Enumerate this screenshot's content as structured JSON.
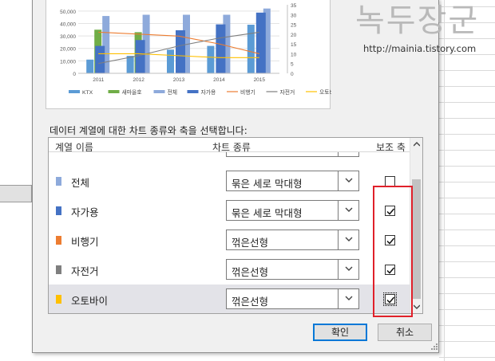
{
  "watermark": {
    "title": "녹두장군",
    "url": "http://mainia.tistory.com"
  },
  "instruction": "데이터 계열에 대한 차트 종류와 축을 선택합니다:",
  "grid": {
    "headers": {
      "name": "계열 이름",
      "type": "차트 종류",
      "axis": "보조 축"
    },
    "rows": [
      {
        "name": "전체",
        "color": "#8eaadb",
        "type": "묶은 세로 막대형",
        "secondary": false
      },
      {
        "name": "자가용",
        "color": "#4472c4",
        "type": "묶은 세로 막대형",
        "secondary": true
      },
      {
        "name": "비행기",
        "color": "#ed7d31",
        "type": "꺾은선형",
        "secondary": true
      },
      {
        "name": "자전거",
        "color": "#7f7f7f",
        "type": "꺾은선형",
        "secondary": true
      },
      {
        "name": "오토바이",
        "color": "#ffc000",
        "type": "꺾은선형",
        "secondary": true,
        "selected": true
      }
    ]
  },
  "buttons": {
    "ok": "확인",
    "cancel": "취소"
  },
  "chart_data": {
    "type": "bar",
    "categories": [
      "2011",
      "2012",
      "2013",
      "2014",
      "2015"
    ],
    "y_primary_ticks": [
      "0",
      "10,000",
      "20,000",
      "30,000",
      "40,000",
      "50,000"
    ],
    "y_secondary_ticks": [
      "0",
      "5",
      "10",
      "15",
      "20",
      "25",
      "30",
      "35"
    ],
    "ylim": [
      0,
      55000
    ],
    "ylim_secondary": [
      0,
      35
    ],
    "series": [
      {
        "name": "KTX",
        "kind": "bar",
        "axis": "primary",
        "color": "#5b9bd5",
        "values": [
          11000,
          14000,
          19000,
          22000,
          39000
        ]
      },
      {
        "name": "새마을호",
        "kind": "bar",
        "axis": "primary",
        "color": "#70ad47",
        "values": [
          35000,
          33000,
          0,
          0,
          0
        ]
      },
      {
        "name": "전체",
        "kind": "bar",
        "axis": "primary",
        "color": "#8eaadb",
        "values": [
          46000,
          47000,
          47000,
          47000,
          52000
        ]
      },
      {
        "name": "자가용",
        "kind": "bar",
        "axis": "secondary",
        "color": "#4472c4",
        "values": [
          14,
          17,
          22,
          25,
          31
        ]
      },
      {
        "name": "비행기",
        "kind": "line",
        "axis": "secondary",
        "color": "#ed7d31",
        "values": [
          21,
          20,
          19,
          15,
          10
        ]
      },
      {
        "name": "자전거",
        "kind": "line",
        "axis": "secondary",
        "color": "#7f7f7f",
        "values": [
          5,
          9,
          14,
          18,
          21
        ]
      },
      {
        "name": "오토바이",
        "kind": "line",
        "axis": "secondary",
        "color": "#ffc000",
        "values": [
          10,
          10,
          9,
          8,
          8
        ]
      }
    ],
    "legend_position": "bottom",
    "grid": true
  }
}
